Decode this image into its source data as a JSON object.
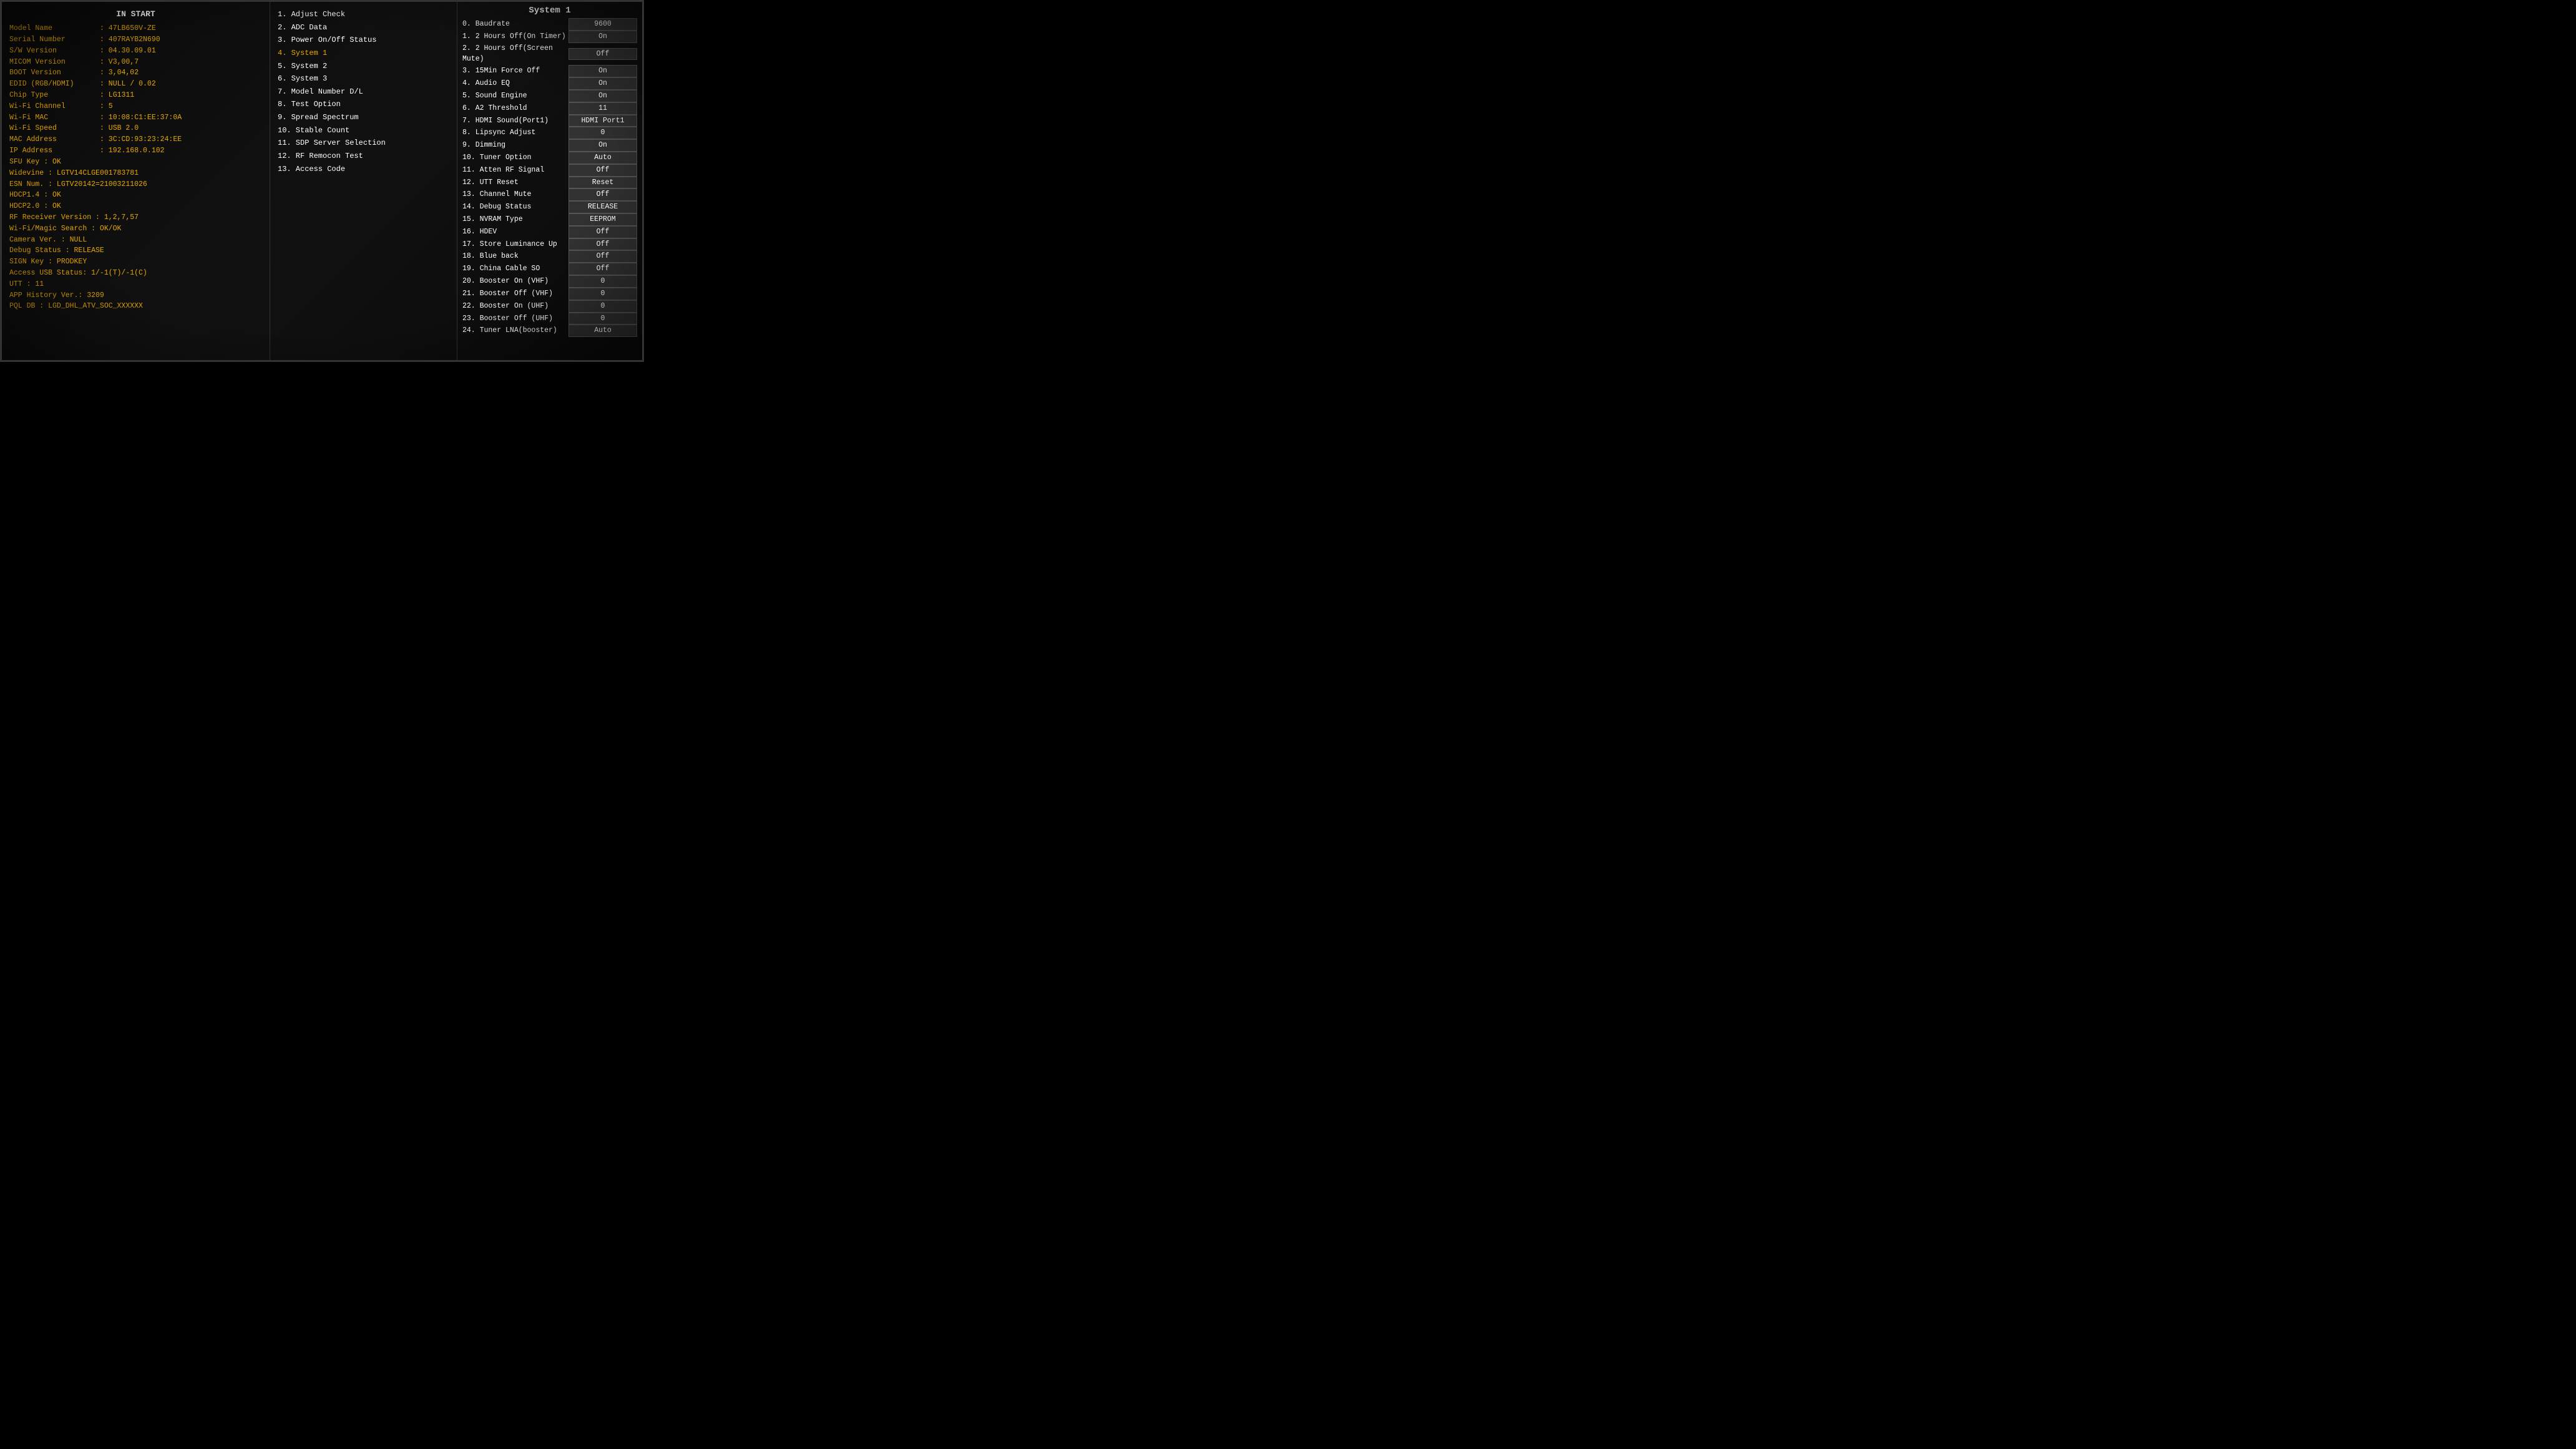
{
  "left": {
    "title": "IN START",
    "rows": [
      {
        "label": "Model Name",
        "value": ": 47LB650V-ZE"
      },
      {
        "label": "Serial Number",
        "value": ": 407RAYB2N690"
      },
      {
        "label": "S/W Version",
        "value": ": 04.30.09.01"
      },
      {
        "label": "MICOM Version",
        "value": ": V3,00,7"
      },
      {
        "label": "BOOT Version",
        "value": ": 3,04,02"
      },
      {
        "label": "EDID (RGB/HDMI)",
        "value": ": NULL / 0.02"
      },
      {
        "label": "Chip Type",
        "value": ": LG1311"
      },
      {
        "label": "Wi-Fi Channel",
        "value": ": 5"
      },
      {
        "label": "Wi-Fi MAC",
        "value": ": 10:08:C1:EE:37:0A"
      },
      {
        "label": "Wi-Fi Speed",
        "value": ": USB 2.0"
      },
      {
        "label": "MAC Address",
        "value": ": 3C:CD:93:23:24:EE"
      },
      {
        "label": "IP Address",
        "value": ": 192.168.0.102"
      }
    ],
    "plain": [
      "SFU Key : OK",
      "Widevine : LGTV14CLGE001783781",
      "ESN Num. : LGTV20142=21003211026",
      "HDCP1.4        : OK",
      "HDCP2.0        : OK",
      "RF Receiver Version   : 1,2,7,57",
      "Wi-Fi/Magic Search   : OK/OK",
      "Camera Ver.    : NULL",
      "Debug Status   : RELEASE",
      "SIGN Key       : PRODKEY",
      "Access USB Status: 1/-1(T)/-1(C)",
      "UTT : 11",
      "APP History Ver.: 3209",
      "PQL DB : LGD_DHL_ATV_SOC_XXXXXX"
    ]
  },
  "middle": {
    "items": [
      {
        "num": "1",
        "label": ". Adjust Check",
        "active": false
      },
      {
        "num": "2",
        "label": ". ADC Data",
        "active": false
      },
      {
        "num": "3",
        "label": ". Power On/Off Status",
        "active": false
      },
      {
        "num": "4",
        "label": ". System 1",
        "active": true
      },
      {
        "num": "5",
        "label": ". System 2",
        "active": false
      },
      {
        "num": "6",
        "label": ". System 3",
        "active": false
      },
      {
        "num": "7",
        "label": ". Model Number D/L",
        "active": false
      },
      {
        "num": "8",
        "label": ". Test Option",
        "active": false
      },
      {
        "num": "9",
        "label": ". Spread Spectrum",
        "active": false
      },
      {
        "num": "10",
        "label": ". Stable Count",
        "active": false
      },
      {
        "num": "11",
        "label": ". SDP Server Selection",
        "active": false
      },
      {
        "num": "12",
        "label": ". RF Remocon Test",
        "active": false
      },
      {
        "num": "13",
        "label": ". Access Code",
        "active": false
      }
    ]
  },
  "right": {
    "title": "System 1",
    "rows": [
      {
        "label": "0. Baudrate",
        "value": "9600"
      },
      {
        "label": "1. 2 Hours Off(On Timer)",
        "value": "On"
      },
      {
        "label": "2. 2 Hours Off(Screen Mute)",
        "value": "Off"
      },
      {
        "label": "3. 15Min Force Off",
        "value": "On"
      },
      {
        "label": "4. Audio EQ",
        "value": "On"
      },
      {
        "label": "5. Sound Engine",
        "value": "On"
      },
      {
        "label": "6. A2 Threshold",
        "value": "11"
      },
      {
        "label": "7. HDMI Sound(Port1)",
        "value": "HDMI Port1"
      },
      {
        "label": "8. Lipsync Adjust",
        "value": "0"
      },
      {
        "label": "9. Dimming",
        "value": "On"
      },
      {
        "label": "10. Tuner Option",
        "value": "Auto"
      },
      {
        "label": "11. Atten RF Signal",
        "value": "Off"
      },
      {
        "label": "12. UTT Reset",
        "value": "Reset"
      },
      {
        "label": "13. Channel Mute",
        "value": "Off"
      },
      {
        "label": "14. Debug Status",
        "value": "RELEASE"
      },
      {
        "label": "15. NVRAM Type",
        "value": "EEPROM"
      },
      {
        "label": "16. HDEV",
        "value": "Off"
      },
      {
        "label": "17. Store Luminance Up",
        "value": "Off"
      },
      {
        "label": "18. Blue back",
        "value": "Off"
      },
      {
        "label": "19. China Cable SO",
        "value": "Off"
      },
      {
        "label": "20. Booster On (VHF)",
        "value": "0"
      },
      {
        "label": "21. Booster Off (VHF)",
        "value": "0"
      },
      {
        "label": "22. Booster On (UHF)",
        "value": "0"
      },
      {
        "label": "23. Booster Off (UHF)",
        "value": "0"
      },
      {
        "label": "24. Tuner LNA(booster)",
        "value": "Auto"
      }
    ]
  }
}
